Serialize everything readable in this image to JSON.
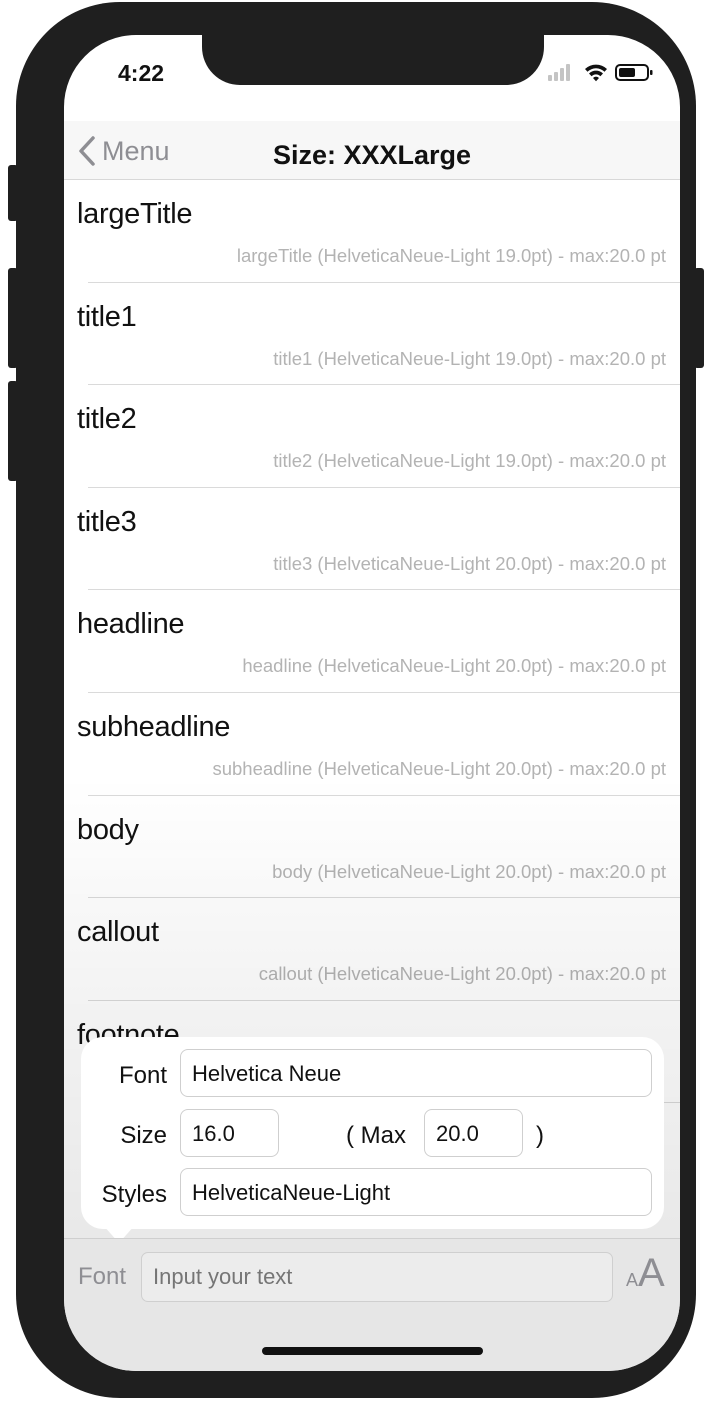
{
  "status": {
    "time": "4:22"
  },
  "nav": {
    "back_label": "Menu",
    "title": "Size: XXXLarge"
  },
  "rows": [
    {
      "title": "largeTitle",
      "detail": "largeTitle (HelveticaNeue-Light 19.0pt) - max:20.0 pt"
    },
    {
      "title": "title1",
      "detail": "title1 (HelveticaNeue-Light 19.0pt) - max:20.0 pt"
    },
    {
      "title": "title2",
      "detail": "title2 (HelveticaNeue-Light 19.0pt) - max:20.0 pt"
    },
    {
      "title": "title3",
      "detail": "title3 (HelveticaNeue-Light 20.0pt) - max:20.0 pt"
    },
    {
      "title": "headline",
      "detail": "headline (HelveticaNeue-Light 20.0pt) - max:20.0 pt"
    },
    {
      "title": "subheadline",
      "detail": "subheadline (HelveticaNeue-Light 20.0pt) - max:20.0 pt"
    },
    {
      "title": "body",
      "detail": "body (HelveticaNeue-Light 20.0pt) - max:20.0 pt"
    },
    {
      "title": "callout",
      "detail": "callout (HelveticaNeue-Light 20.0pt) - max:20.0 pt"
    },
    {
      "title": "footnote",
      "detail": ""
    }
  ],
  "popover": {
    "font_label": "Font",
    "font_value": "Helvetica Neue",
    "size_label": "Size",
    "size_value": "16.0",
    "max_open": "( Max",
    "max_value": "20.0",
    "max_close": ")",
    "styles_label": "Styles",
    "styles_value": "HelveticaNeue-Light"
  },
  "toolbar": {
    "font_label": "Font",
    "input_placeholder": "Input your text",
    "aa_small": "A",
    "aa_big": "A"
  }
}
